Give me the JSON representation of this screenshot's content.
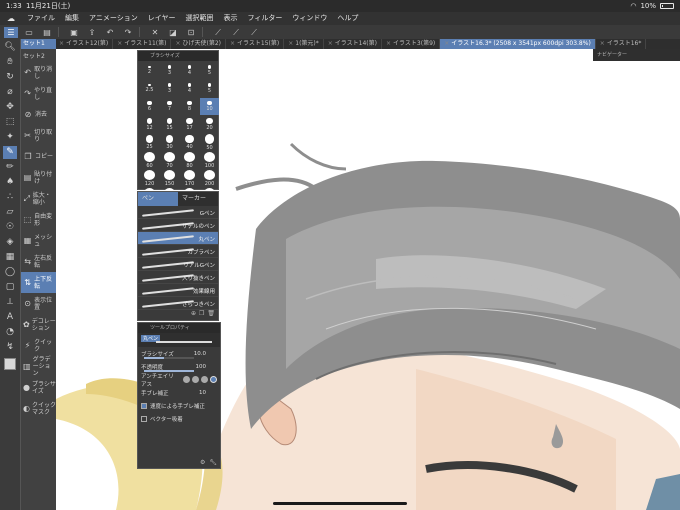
{
  "status": {
    "time": "1:33",
    "date": "11月21日(土)",
    "battery": "10%"
  },
  "menubar": {
    "items": [
      "ファイル",
      "編集",
      "アニメーション",
      "レイヤー",
      "選択範囲",
      "表示",
      "フィルター",
      "ウィンドウ",
      "ヘルプ"
    ]
  },
  "tabs": [
    {
      "label": "イラスト12(第)"
    },
    {
      "label": "イラスト11(第)"
    },
    {
      "label": "ひげ天使(第2)"
    },
    {
      "label": "イラスト15(第)"
    },
    {
      "label": "1(第元)*"
    },
    {
      "label": "イラスト14(第)"
    },
    {
      "label": "イラスト3(第9)"
    },
    {
      "label": "イラスト16.3* (2508 x 3541px 600dpi 303.8%)"
    },
    {
      "label": "イラスト16*"
    }
  ],
  "subtool": {
    "header": "セット1",
    "set_label": "セット2",
    "items": [
      "取り消し",
      "やり直し",
      "消去",
      "切り取り",
      "コピー",
      "貼り付け",
      "拡大・縮小",
      "自由変形",
      "メッシュ",
      "左右反転",
      "上下反転",
      "表示位置",
      "デコレーション",
      "クイック",
      "グラデーション",
      "プラシサイズ",
      "クイックマスク"
    ]
  },
  "brushsize": {
    "title": "ブラシサイズ",
    "sizes": [
      "2",
      "3",
      "4",
      "5",
      "2.5",
      "3",
      "4",
      "5",
      "6",
      "7",
      "8",
      "10",
      "12",
      "15",
      "17",
      "20",
      "25",
      "30",
      "40",
      "50",
      "60",
      "70",
      "80",
      "100",
      "120",
      "150",
      "170",
      "200",
      "250",
      "300",
      "400",
      "500"
    ],
    "selected": "10"
  },
  "penpanel": {
    "tabs": [
      "ペン",
      "マーカー"
    ],
    "items": [
      "Gペン",
      "サデルのペン",
      "丸ペン",
      "カブラペン",
      "リアルGペン",
      "入り抜きペン",
      "効果線用",
      "ざらつきペン"
    ],
    "selected": "丸ペン"
  },
  "toolprop": {
    "title": "ツールプロパティ",
    "tool_name": "丸ペン",
    "brush_size_label": "ブラシサイズ",
    "brush_size_value": "10.0",
    "opacity_label": "不透明度",
    "opacity_value": "100",
    "antialias_label": "アンチエイリアス",
    "stabilization_label": "手ブレ補正",
    "stabilization_value": "10",
    "speed_label": "速度による手ブレ補正",
    "vector_label": "ベクター吸着"
  },
  "navigator": {
    "title": "ナビゲーター"
  }
}
